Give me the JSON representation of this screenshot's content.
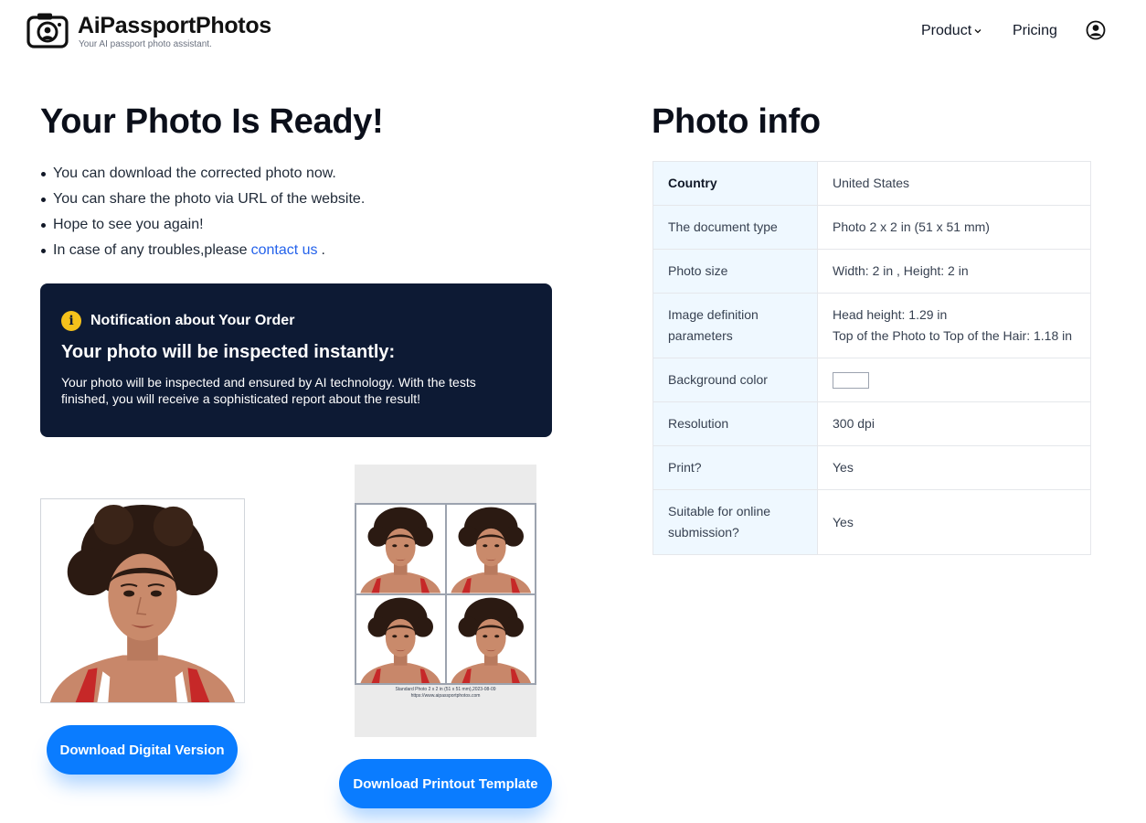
{
  "brand": {
    "name": "AiPassportPhotos",
    "tagline": "Your AI passport photo assistant."
  },
  "nav": {
    "product": "Product",
    "pricing": "Pricing"
  },
  "left": {
    "title": "Your Photo Is Ready!",
    "bullets": {
      "b1": "You can download the corrected photo now.",
      "b2": "You can share the photo via URL of the website.",
      "b3": "Hope to see you again!",
      "b4_prefix": "In case of any troubles,please",
      "b4_link": "contact us",
      "b4_suffix": "."
    },
    "notice": {
      "title": "Notification about Your Order",
      "heading": "Your photo will be inspected instantly:",
      "body": "Your photo will be inspected and ensured by AI technology. With the tests finished, you will receive a sophisticated report about the result!"
    },
    "sheet_caption_line1": "Standard Photo 2 x 2 in (51 x 51 mm),2023-08-09",
    "sheet_caption_line2": "https://www.aipassportphotos.com",
    "buttons": {
      "digital": "Download Digital Version",
      "print": "Download Printout Template"
    }
  },
  "info": {
    "title": "Photo info",
    "rows": [
      {
        "key": "Country",
        "value": "United States"
      },
      {
        "key": "The document type",
        "value": "Photo 2 x 2 in (51 x 51 mm)"
      },
      {
        "key": "Photo size",
        "value": "Width: 2 in , Height: 2 in"
      },
      {
        "key": "Image definition parameters",
        "value": "Head height: 1.29 in",
        "value2": "Top of the Photo to Top of the Hair: 1.18 in"
      },
      {
        "key": "Background color",
        "value": "",
        "swatch": "#ffffff"
      },
      {
        "key": "Resolution",
        "value": "300 dpi"
      },
      {
        "key": "Print?",
        "value": "Yes"
      },
      {
        "key": "Suitable for online submission?",
        "value": "Yes"
      }
    ]
  },
  "colors": {
    "accent": "#0a7cff",
    "notice_bg": "#0d1a34",
    "info_icon": "#f5c21b",
    "link": "#2563eb",
    "table_key_bg": "#eff8ff"
  }
}
